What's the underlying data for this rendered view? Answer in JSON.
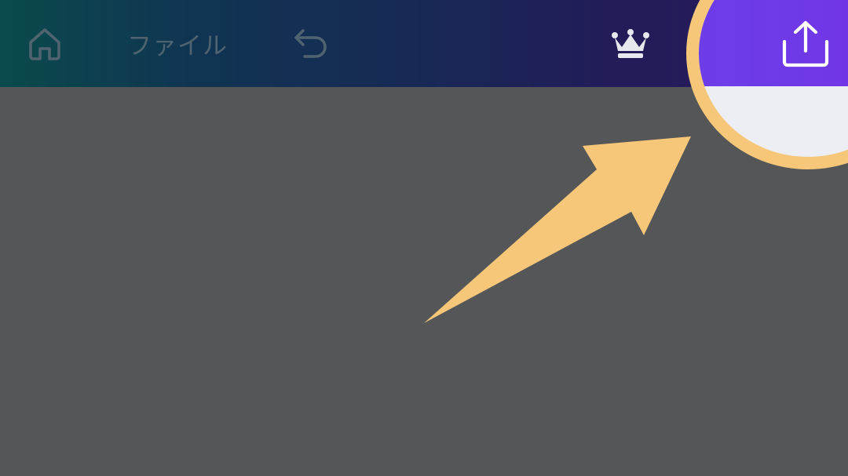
{
  "topbar": {
    "home_icon": "home-icon",
    "file_label": "ファイル",
    "undo_icon": "undo-icon",
    "premium_icon": "crown-icon",
    "share_icon": "share-upload-icon"
  },
  "annotation": {
    "highlight": "circle-highlight",
    "pointer": "arrow-pointer"
  },
  "colors": {
    "accent_purple": "#7233e6",
    "highlight_orange": "#f6c779",
    "canvas_gray": "#545658"
  }
}
